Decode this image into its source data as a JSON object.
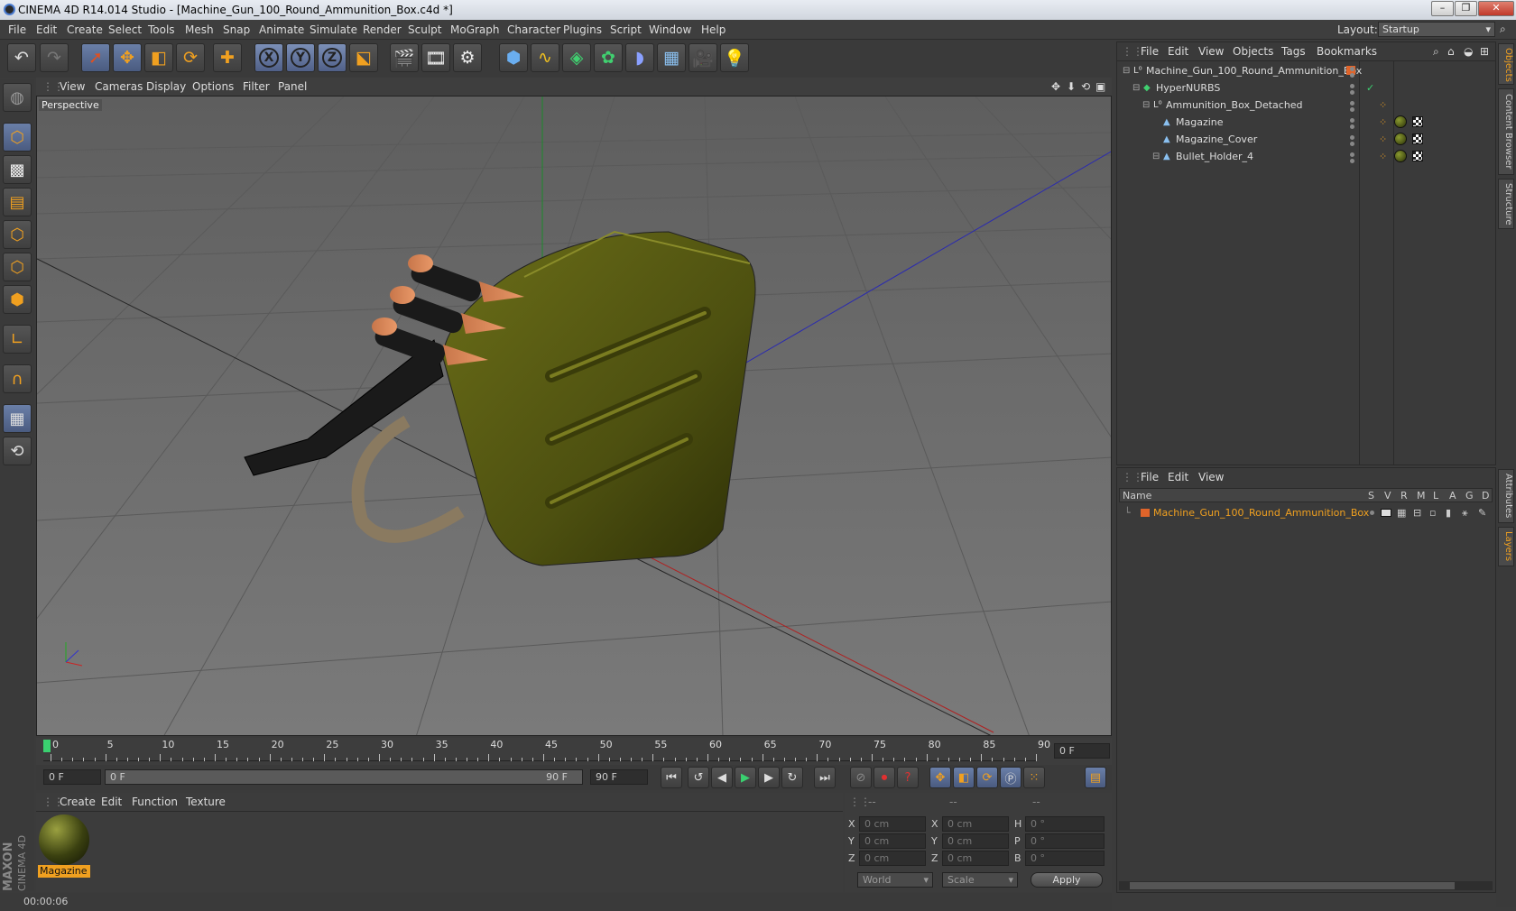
{
  "window": {
    "title": "CINEMA 4D R14.014 Studio - [Machine_Gun_100_Round_Ammunition_Box.c4d *]",
    "controls": [
      "–",
      "❐",
      "✕"
    ]
  },
  "menubar": {
    "items": [
      "File",
      "Edit",
      "Create",
      "Select",
      "Tools",
      "Mesh",
      "Snap",
      "Animate",
      "Simulate",
      "Render",
      "Sculpt",
      "MoGraph",
      "Character",
      "Plugins",
      "Script",
      "Window",
      "Help"
    ],
    "layout_label": "Layout:",
    "layout_value": "Startup"
  },
  "toolbar": {
    "icons": [
      "undo-icon",
      "redo-icon",
      "select-icon",
      "move-icon",
      "scale-icon",
      "rotate-icon",
      "add-icon",
      "x-axis-icon",
      "y-axis-icon",
      "z-axis-icon",
      "world-coord-icon",
      "render-view-icon",
      "render-picture-icon",
      "render-settings-icon",
      "cube-icon",
      "spline-icon",
      "nurbs-icon",
      "array-icon",
      "deformer-icon",
      "floor-icon",
      "camera-icon",
      "light-icon"
    ]
  },
  "viewport": {
    "menu": [
      "View",
      "Cameras",
      "Display",
      "Options",
      "Filter",
      "Panel"
    ],
    "label": "Perspective"
  },
  "timeline": {
    "ticks": [
      "0",
      "5",
      "10",
      "15",
      "20",
      "25",
      "30",
      "35",
      "40",
      "45",
      "50",
      "55",
      "60",
      "65",
      "70",
      "75",
      "80",
      "85",
      "90"
    ],
    "current_frame": "0 F"
  },
  "playbar": {
    "start": "0 F",
    "range_start": "0 F",
    "range_end": "90 F",
    "end": "90 F"
  },
  "material_panel": {
    "menu": [
      "Create",
      "Edit",
      "Function",
      "Texture"
    ],
    "materials": [
      {
        "name": "Magazine"
      }
    ]
  },
  "coord_panel": {
    "headers": [
      "--",
      "--",
      "--"
    ],
    "rows": [
      {
        "a": "X",
        "a_val": "0 cm",
        "b": "X",
        "b_val": "0 cm",
        "c": "H",
        "c_val": "0 °"
      },
      {
        "a": "Y",
        "a_val": "0 cm",
        "b": "Y",
        "b_val": "0 cm",
        "c": "P",
        "c_val": "0 °"
      },
      {
        "a": "Z",
        "a_val": "0 cm",
        "b": "Z",
        "b_val": "0 cm",
        "c": "B",
        "c_val": "0 °"
      }
    ],
    "world": "World",
    "scale": "Scale",
    "apply": "Apply"
  },
  "status": {
    "time": "00:00:06"
  },
  "objects_panel": {
    "menu": [
      "File",
      "Edit",
      "View",
      "Objects",
      "Tags",
      "Bookmarks"
    ],
    "items": [
      {
        "name": "Machine_Gun_100_Round_Ammunition_Box",
        "indent": 0
      },
      {
        "name": "HyperNURBS",
        "indent": 1
      },
      {
        "name": "Ammunition_Box_Detached",
        "indent": 2
      },
      {
        "name": "Magazine",
        "indent": 3
      },
      {
        "name": "Magazine_Cover",
        "indent": 3
      },
      {
        "name": "Bullet_Holder_4",
        "indent": 3
      }
    ]
  },
  "layers_panel": {
    "menu": [
      "File",
      "Edit",
      "View"
    ],
    "columns": [
      "Name",
      "S",
      "V",
      "R",
      "M",
      "L",
      "A",
      "G",
      "D"
    ],
    "row": "Machine_Gun_100_Round_Ammunition_Box"
  },
  "side_tabs": [
    "Objects",
    "Content Browser",
    "Structure",
    "Attributes",
    "Layers"
  ],
  "branding": {
    "maxon": "MAXON",
    "cinema": "CINEMA 4D"
  },
  "colors": {
    "accent": "#f0a020",
    "layer_color": "#e0642a",
    "viewport_bg": "#6a6a6a"
  }
}
